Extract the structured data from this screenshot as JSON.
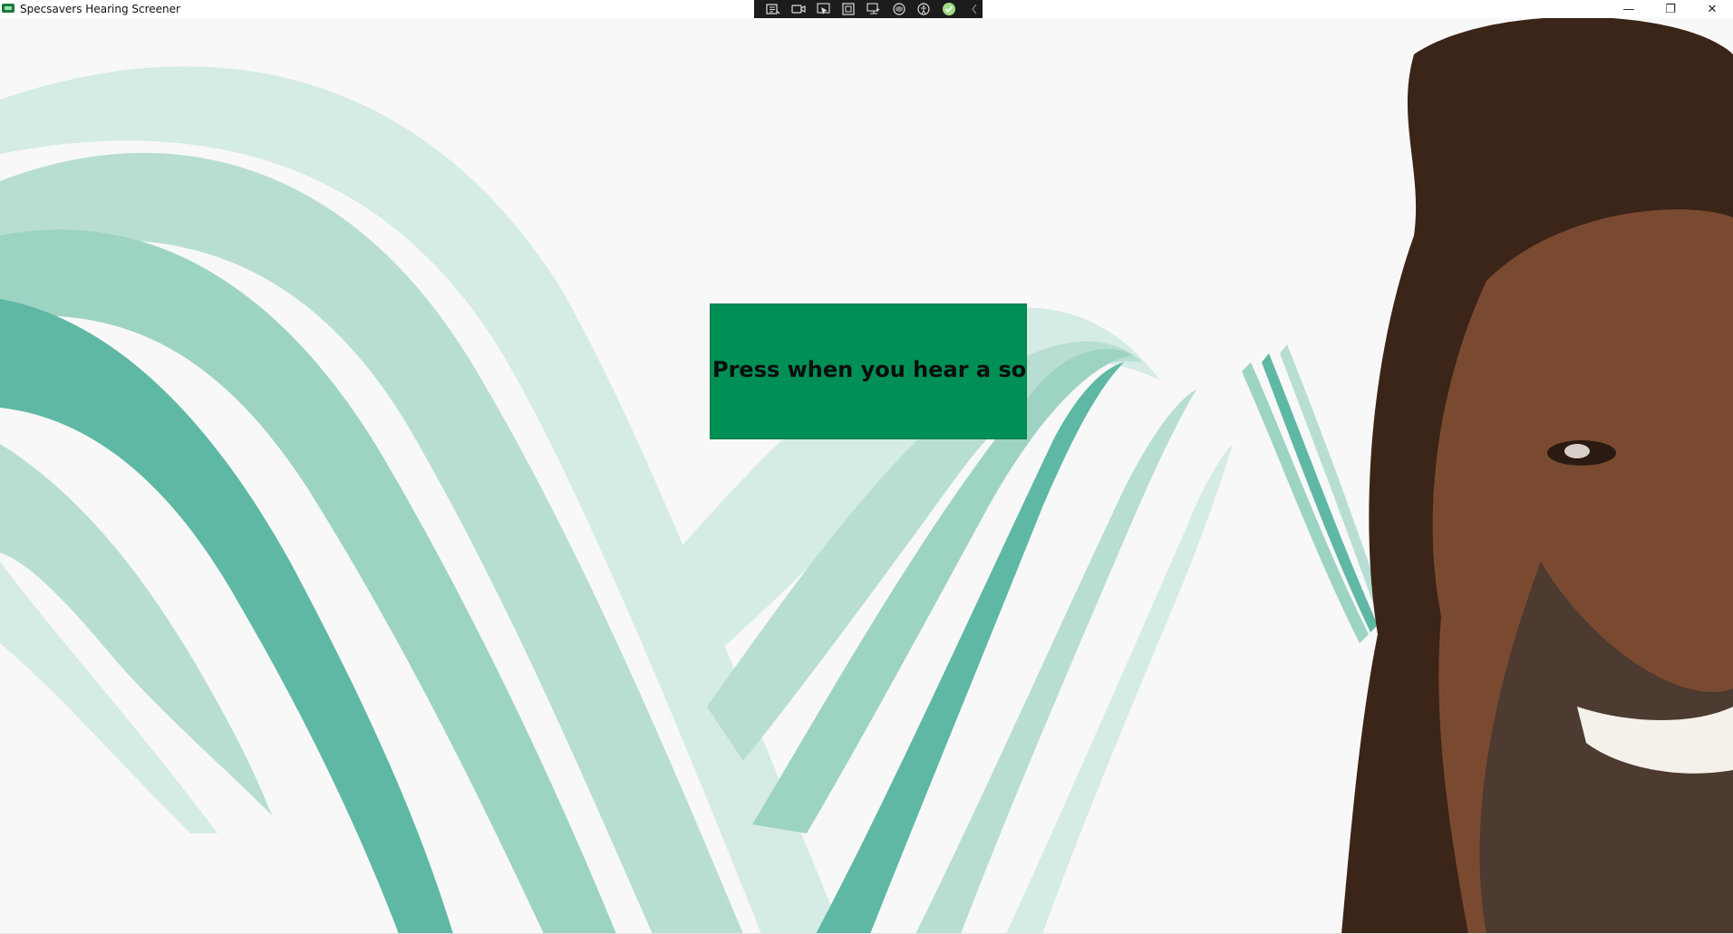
{
  "window": {
    "title": "Specsavers Hearing Screener",
    "controls": {
      "minimize": "—",
      "restore": "❐",
      "close": "✕"
    }
  },
  "toolbar": {
    "icons": [
      "record-screen-icon",
      "video-icon",
      "pointer-icon",
      "window-select-icon",
      "region-icon",
      "accessibility-audio-icon",
      "accessibility-icon",
      "status-ok-icon",
      "collapse-icon"
    ]
  },
  "main": {
    "button_label": "Press when you hear a sound"
  },
  "colors": {
    "button_green": "#008f55",
    "ribbon_light": "#d5ebe5",
    "ribbon_mid": "#9dd3c3",
    "ribbon_dark": "#5fb8a3",
    "background": "#f8f8f8"
  }
}
